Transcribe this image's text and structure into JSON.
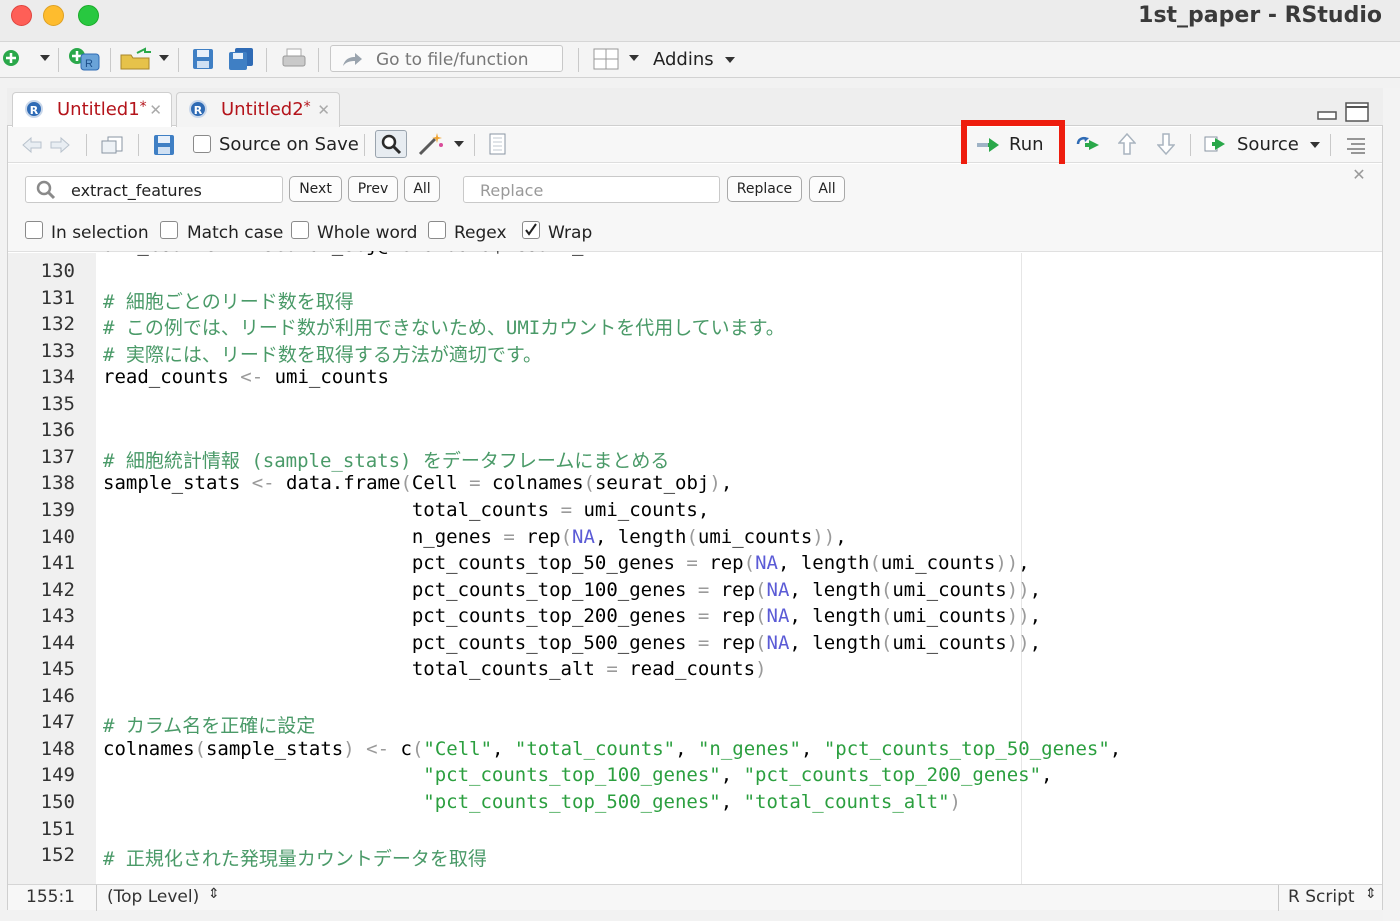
{
  "window": {
    "title": "1st_paper - RStudio"
  },
  "main_toolbar": {
    "goto_placeholder": "Go to file/function",
    "addins": "Addins"
  },
  "tabs": [
    {
      "label": "Untitled1",
      "modified": "*"
    },
    {
      "label": "Untitled2",
      "modified": "*"
    }
  ],
  "editor_toolbar": {
    "source_on_save": "Source on Save",
    "run": "Run",
    "source": "Source"
  },
  "find": {
    "search_value": "extract_features",
    "next": "Next",
    "prev": "Prev",
    "all": "All",
    "replace_placeholder": "Replace",
    "replace": "Replace",
    "replace_all": "All",
    "in_selection": "In selection",
    "match_case": "Match case",
    "whole_word": "Whole word",
    "regex": "Regex",
    "wrap": "Wrap",
    "wrap_checked": true
  },
  "code": {
    "partial_top": "umi_counts <- seurat_obj@meta.data$nCount_RNA",
    "line_numbers": [
      "130",
      "131",
      "132",
      "133",
      "134",
      "135",
      "136",
      "137",
      "138",
      "139",
      "140",
      "141",
      "142",
      "143",
      "144",
      "145",
      "146",
      "147",
      "148",
      "149",
      "150",
      "151",
      "152"
    ],
    "lines": [
      "",
      "# 細胞ごとのリード数を取得",
      "# この例では、リード数が利用できないため、UMIカウントを代用しています。",
      "# 実際には、リード数を取得する方法が適切です。",
      "read_counts <- umi_counts",
      "",
      "",
      "# 細胞統計情報 (sample_stats) をデータフレームにまとめる",
      "sample_stats <- data.frame(Cell = colnames(seurat_obj),",
      "                           total_counts = umi_counts,",
      "                           n_genes = rep(NA, length(umi_counts)),",
      "                           pct_counts_top_50_genes = rep(NA, length(umi_counts)),",
      "                           pct_counts_top_100_genes = rep(NA, length(umi_counts)),",
      "                           pct_counts_top_200_genes = rep(NA, length(umi_counts)),",
      "                           pct_counts_top_500_genes = rep(NA, length(umi_counts)),",
      "                           total_counts_alt = read_counts)",
      "",
      "# カラム名を正確に設定",
      "colnames(sample_stats) <- c(\"Cell\", \"total_counts\", \"n_genes\", \"pct_counts_top_50_genes\",",
      "                            \"pct_counts_top_100_genes\", \"pct_counts_top_200_genes\",",
      "                            \"pct_counts_top_500_genes\", \"total_counts_alt\")",
      "",
      "# 正規化された発現量カウントデータを取得"
    ]
  },
  "status": {
    "position": "155:1",
    "scope": "(Top Level)",
    "file_type": "R Script"
  },
  "colors": {
    "comment": "#4a9a68",
    "string": "#2b9f3f",
    "keyword": "#5b5bd6",
    "tab_title": "#b4141b",
    "highlight": "#ee1d0e"
  }
}
